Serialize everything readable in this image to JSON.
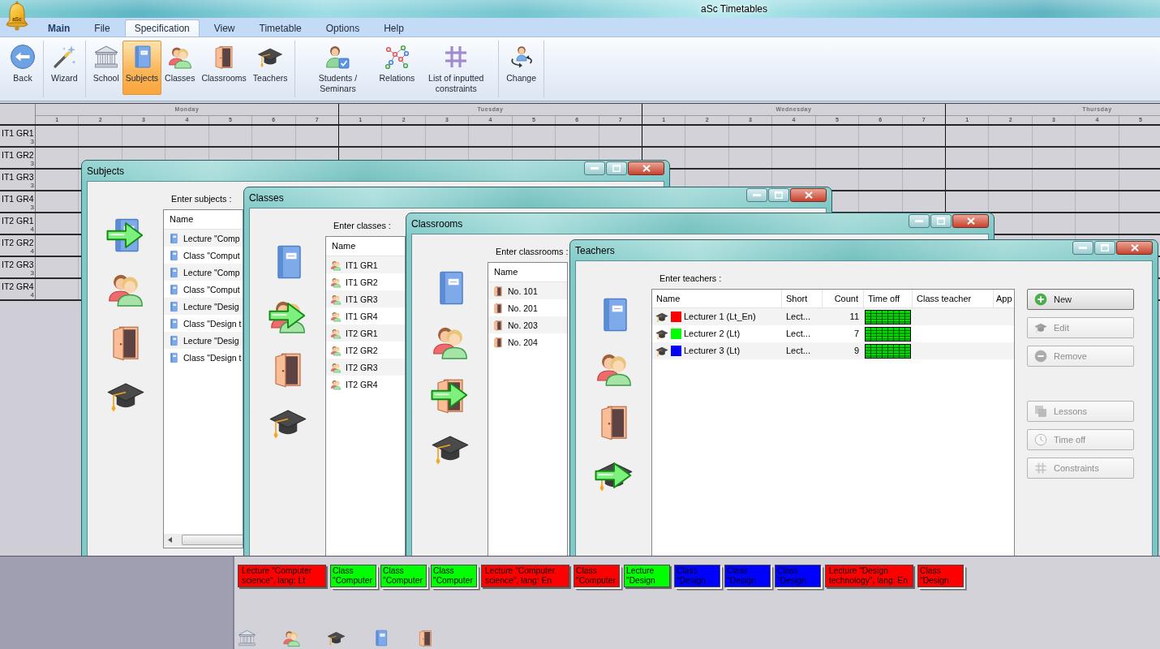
{
  "app": {
    "logo_text": "aSc",
    "title": "aSc Timetables"
  },
  "menu": {
    "app_button": "Main",
    "tabs": [
      {
        "label": "File",
        "selected": false
      },
      {
        "label": "Specification",
        "selected": true
      },
      {
        "label": "View",
        "selected": false
      },
      {
        "label": "Timetable",
        "selected": false
      },
      {
        "label": "Options",
        "selected": false
      },
      {
        "label": "Help",
        "selected": false
      }
    ]
  },
  "ribbon": {
    "groups": [
      [
        {
          "kind": "back",
          "label": "Back",
          "selected": false
        }
      ],
      [
        {
          "kind": "wizard",
          "label": "Wizard",
          "selected": false
        }
      ],
      [
        {
          "kind": "school",
          "label": "School",
          "selected": false
        },
        {
          "kind": "book",
          "label": "Subjects",
          "selected": true
        },
        {
          "kind": "people",
          "label": "Classes",
          "selected": false
        },
        {
          "kind": "door",
          "label": "Classrooms",
          "selected": false
        },
        {
          "kind": "cap",
          "label": "Teachers",
          "selected": false
        }
      ],
      [
        {
          "kind": "student",
          "label": "Students / Seminars",
          "selected": false
        },
        {
          "kind": "network",
          "label": "Relations",
          "selected": false
        },
        {
          "kind": "hash",
          "label": "List of inputted constraints",
          "selected": false
        }
      ],
      [
        {
          "kind": "change",
          "label": "Change",
          "selected": false
        }
      ]
    ]
  },
  "timetable": {
    "days": [
      {
        "name": "Monday",
        "periods": [
          "1",
          "2",
          "3",
          "4",
          "5",
          "6",
          "7"
        ]
      },
      {
        "name": "Tuesday",
        "periods": [
          "1",
          "2",
          "3",
          "4",
          "5",
          "6",
          "7"
        ]
      },
      {
        "name": "Wednesday",
        "periods": [
          "1",
          "2",
          "3",
          "4",
          "5",
          "6",
          "7"
        ]
      },
      {
        "name": "Thursday",
        "periods": [
          "1",
          "2",
          "3",
          "4",
          "5"
        ]
      }
    ],
    "rows": [
      {
        "name": "IT1 GR1",
        "count": "3"
      },
      {
        "name": "IT1 GR2",
        "count": "3"
      },
      {
        "name": "IT1 GR3",
        "count": "3"
      },
      {
        "name": "IT1 GR4",
        "count": "3"
      },
      {
        "name": "IT2 GR1",
        "count": "4"
      },
      {
        "name": "IT2 GR2",
        "count": "4"
      },
      {
        "name": "IT2 GR3",
        "count": "3"
      },
      {
        "name": "IT2 GR4",
        "count": "4"
      }
    ]
  },
  "windows": [
    {
      "kind": "list",
      "title": "Subjects",
      "prompt": "Enter subjects :",
      "nav": [
        {
          "kind": "book",
          "selected": true
        },
        {
          "kind": "people",
          "selected": false
        },
        {
          "kind": "door",
          "selected": false
        },
        {
          "kind": "cap",
          "selected": false
        }
      ],
      "columns": [
        "Name"
      ],
      "items": [
        {
          "kind": "book",
          "label": "Lecture \"Comp"
        },
        {
          "kind": "book",
          "label": "Class \"Comput"
        },
        {
          "kind": "book",
          "label": "Lecture \"Comp"
        },
        {
          "kind": "book",
          "label": "Class \"Comput"
        },
        {
          "kind": "book",
          "label": "Lecture \"Desig"
        },
        {
          "kind": "book",
          "label": "Class \"Design t"
        },
        {
          "kind": "book",
          "label": "Lecture \"Desig"
        },
        {
          "kind": "book",
          "label": "Class \"Design t"
        }
      ],
      "horizontal_scrollbar": true
    },
    {
      "kind": "list",
      "title": "Classes",
      "prompt": "Enter classes :",
      "nav": [
        {
          "kind": "book",
          "selected": false
        },
        {
          "kind": "people",
          "selected": true
        },
        {
          "kind": "door",
          "selected": false
        },
        {
          "kind": "cap",
          "selected": false
        }
      ],
      "columns": [
        "Name"
      ],
      "items": [
        {
          "kind": "people",
          "label": "IT1 GR1"
        },
        {
          "kind": "people",
          "label": "IT1 GR2"
        },
        {
          "kind": "people",
          "label": "IT1 GR3"
        },
        {
          "kind": "people",
          "label": "IT1 GR4"
        },
        {
          "kind": "people",
          "label": "IT2 GR1"
        },
        {
          "kind": "people",
          "label": "IT2 GR2"
        },
        {
          "kind": "people",
          "label": "IT2 GR3"
        },
        {
          "kind": "people",
          "label": "IT2 GR4"
        }
      ]
    },
    {
      "kind": "list",
      "title": "Classrooms",
      "prompt": "Enter classrooms :",
      "nav": [
        {
          "kind": "book",
          "selected": false
        },
        {
          "kind": "people",
          "selected": false
        },
        {
          "kind": "door",
          "selected": true
        },
        {
          "kind": "cap",
          "selected": false
        }
      ],
      "columns": [
        "Name"
      ],
      "items": [
        {
          "kind": "door",
          "label": "No. 101"
        },
        {
          "kind": "door",
          "label": "No. 201"
        },
        {
          "kind": "door",
          "label": "No. 203"
        },
        {
          "kind": "door",
          "label": "No. 204"
        }
      ]
    },
    {
      "kind": "table",
      "title": "Teachers",
      "prompt": "Enter teachers :",
      "nav": [
        {
          "kind": "book",
          "selected": false
        },
        {
          "kind": "people",
          "selected": false
        },
        {
          "kind": "door",
          "selected": false
        },
        {
          "kind": "cap",
          "selected": true
        }
      ],
      "columns": [
        "Name",
        "Short",
        "Count",
        "Time off",
        "Class teacher",
        "App"
      ],
      "rows": [
        {
          "name": "Lecturer 1 (Lt_En)",
          "color": "#ff0000",
          "short": "Lect...",
          "count": "11"
        },
        {
          "name": "Lecturer 2 (Lt)",
          "color": "#00ff00",
          "short": "Lect...",
          "count": "7"
        },
        {
          "name": "Lecturer 3 (Lt)",
          "color": "#0000ff",
          "short": "Lect...",
          "count": "9"
        }
      ],
      "buttons": [
        [
          {
            "kind": "new",
            "label": "New",
            "disabled": false
          },
          {
            "kind": "edit",
            "label": "Edit",
            "disabled": true
          },
          {
            "kind": "remove",
            "label": "Remove",
            "disabled": true
          }
        ],
        [
          {
            "kind": "lessons",
            "label": "Lessons",
            "disabled": true
          },
          {
            "kind": "timeoff",
            "label": "Time off",
            "disabled": true
          },
          {
            "kind": "constraints",
            "label": "Constraints",
            "disabled": true
          }
        ]
      ]
    }
  ],
  "lesson_cards": [
    {
      "text": "Lecture \"Computer science\", lang: Lt",
      "color": "#ff0000",
      "kind": "double",
      "stacked": false
    },
    {
      "text": "Class \"Computer",
      "color": "#00ff00",
      "kind": "single",
      "stacked": true
    },
    {
      "text": "Class \"Computer",
      "color": "#00ff00",
      "kind": "single",
      "stacked": true
    },
    {
      "text": "Class \"Computer",
      "color": "#00ff00",
      "kind": "single",
      "stacked": true
    },
    {
      "text": "Lecture \"Computer science\", lang: En",
      "color": "#ff0000",
      "kind": "double",
      "stacked": false
    },
    {
      "text": "Class \"Computer",
      "color": "#ff0000",
      "kind": "single",
      "stacked": true
    },
    {
      "text": "Lecture \"Design",
      "color": "#00ff00",
      "kind": "single",
      "stacked": false
    },
    {
      "text": "Class \"Design",
      "color": "#0000ff",
      "kind": "single",
      "stacked": true
    },
    {
      "text": "Class \"Design",
      "color": "#0000ff",
      "kind": "single",
      "stacked": true
    },
    {
      "text": "Class \"Design",
      "color": "#0000ff",
      "kind": "single",
      "stacked": true
    },
    {
      "text": "Lecture \"Design technology\", lang: En",
      "color": "#ff0000",
      "kind": "double",
      "stacked": false
    },
    {
      "text": "Class \"Design",
      "color": "#ff0000",
      "kind": "single",
      "stacked": true
    }
  ]
}
